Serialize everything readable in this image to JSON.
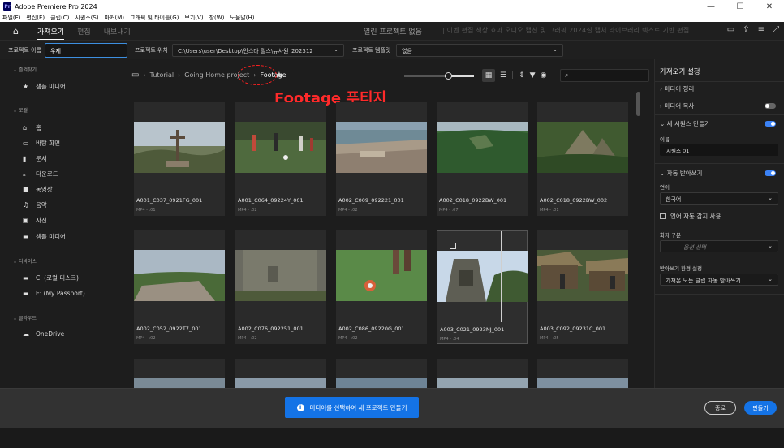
{
  "window": {
    "title": "Adobe Premiere Pro 2024",
    "app_badge": "Pr",
    "controls": [
      "—",
      "☐",
      "✕"
    ]
  },
  "menu": [
    "파일(F)",
    "편집(E)",
    "클립(C)",
    "시퀀스(S)",
    "마커(M)",
    "그래픽 및 타이틀(G)",
    "보기(V)",
    "창(W)",
    "도움말(H)"
  ],
  "header": {
    "tabs": [
      {
        "label": "가져오기",
        "active": true
      },
      {
        "label": "편집",
        "active": false
      },
      {
        "label": "내보내기",
        "active": false
      }
    ],
    "center_text": "열린 프로젝트 없음",
    "right_text": "| 이벤 편집  색상  효과  오디오  캡션 및 그래픽  2024설  캡처  라이브러리  텍스트 기반 편집"
  },
  "project_bar": {
    "name_label": "프로젝트 이름",
    "name_value": "우제",
    "location_label": "프로젝트 위치",
    "location_value": "C:\\Users\\user\\Desktop\\인스타 릴스\\뉴사원_202312",
    "template_label": "프로젝트 템플릿",
    "template_value": "없음"
  },
  "sidebar": {
    "favorites_label": "즐겨찾기",
    "favorites": [
      {
        "icon": "star-icon",
        "label": "샘플 미디어"
      }
    ],
    "local_label": "로컬",
    "local": [
      {
        "icon": "home-icon",
        "label": "홈"
      },
      {
        "icon": "desktop-icon",
        "label": "바탕 화면"
      },
      {
        "icon": "document-icon",
        "label": "문서"
      },
      {
        "icon": "download-icon",
        "label": "다운로드"
      },
      {
        "icon": "video-icon",
        "label": "동영상"
      },
      {
        "icon": "music-icon",
        "label": "음악"
      },
      {
        "icon": "photo-icon",
        "label": "사진"
      },
      {
        "icon": "folder-icon",
        "label": "샘플 미디어"
      }
    ],
    "devices_label": "디바이스",
    "devices": [
      {
        "icon": "folder-icon",
        "label": "C: (로컬 디스크)"
      },
      {
        "icon": "folder-icon",
        "label": "E: (My Passport)"
      }
    ],
    "cloud_label": "클라우드",
    "cloud": [
      {
        "icon": "cloud-icon",
        "label": "OneDrive"
      }
    ]
  },
  "browser": {
    "breadcrumb": [
      "Tutorial",
      "Going Home project",
      "Footage"
    ],
    "annotation": "Footage 푸티지",
    "search_placeholder": "",
    "clips": [
      {
        "name": "A001_C037_0921FG_001",
        "meta": "MP4 - :01",
        "scene": "cross"
      },
      {
        "name": "A001_C064_09224Y_001",
        "meta": "MP4 - :02",
        "scene": "soccer"
      },
      {
        "name": "A002_C009_092221_001",
        "meta": "MP4 - :02",
        "scene": "town"
      },
      {
        "name": "A002_C018_0922BW_001",
        "meta": "MP4 - :07",
        "scene": "jungle"
      },
      {
        "name": "A002_C018_0922BW_002",
        "meta": "MP4 - :01",
        "scene": "pyramid"
      },
      {
        "name": "A002_C052_0922T7_001",
        "meta": "MP4 - :02",
        "scene": "cliff"
      },
      {
        "name": "A002_C076_092251_001",
        "meta": "MP4 - :02",
        "scene": "wall"
      },
      {
        "name": "A002_C086_09220G_001",
        "meta": "MP4 - :02",
        "scene": "ball"
      },
      {
        "name": "A003_C021_0923NJ_001",
        "meta": "MP4 - :04",
        "scene": "temple"
      },
      {
        "name": "A003_C092_09231C_001",
        "meta": "MP4 - :05",
        "scene": "huts"
      }
    ]
  },
  "settings": {
    "title": "가져오기 설정",
    "organize_label": "미디어 정리",
    "copy_label": "미디어 복사",
    "copy_on": false,
    "new_seq_label": "새 시퀀스 만들기",
    "new_seq_on": true,
    "name_label": "이름",
    "name_value": "시퀀스 01",
    "autosub_label": "자동 받아쓰기",
    "autosub_on": true,
    "lang_label": "언어",
    "lang_value": "한국어",
    "autodetect_label": "언어 자동 감지 사용",
    "speaker_label": "화자 구분",
    "speaker_placeholder": "옵션 선택",
    "env_label": "받아쓰기 환경 설정",
    "env_value": "가져온 모든 클립 자동 받아쓰기"
  },
  "bottom": {
    "info_label": "미디어를 선택하여 새 프로젝트 만들기",
    "end_label": "종료",
    "create_label": "만들기"
  }
}
